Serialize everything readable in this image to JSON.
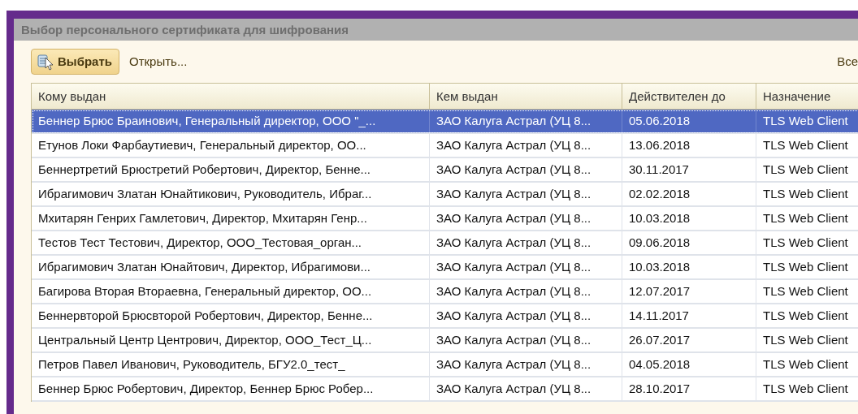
{
  "window": {
    "title": "Выбор персонального сертификата для шифрования"
  },
  "toolbar": {
    "select_button": "Выбрать",
    "open_button": "Открыть...",
    "all_actions": "Все"
  },
  "table": {
    "columns": [
      "Кому выдан",
      "Кем выдан",
      "Действителен до",
      "Назначение"
    ],
    "rows": [
      {
        "selected": true,
        "cells": [
          "Беннер Брюс Браинович, Генеральный директор, ООО \"_...",
          "ЗАО Калуга Астрал (УЦ 8...",
          "05.06.2018",
          "TLS Web Client"
        ]
      },
      {
        "selected": false,
        "cells": [
          "Етунов Локи Фарбаутиевич, Генеральный директор, ОО...",
          "ЗАО Калуга Астрал (УЦ 8...",
          "13.06.2018",
          "TLS Web Client"
        ]
      },
      {
        "selected": false,
        "cells": [
          "Беннертретий Брюстретий Робертович, Директор, Бенне...",
          "ЗАО Калуга Астрал (УЦ 8...",
          "30.11.2017",
          "TLS Web Client"
        ]
      },
      {
        "selected": false,
        "cells": [
          "Ибрагимович Златан Юнайтикович, Руководитель, Ибраг...",
          "ЗАО Калуга Астрал (УЦ 8...",
          "02.02.2018",
          "TLS Web Client"
        ]
      },
      {
        "selected": false,
        "cells": [
          "Мхитарян Генрих Гамлетович, Директор, Мхитарян Генр...",
          "ЗАО Калуга Астрал (УЦ 8...",
          "10.03.2018",
          "TLS Web Client"
        ]
      },
      {
        "selected": false,
        "cells": [
          "Тестов Тест Тестович, Директор, ООО_Тестовая_орган...",
          "ЗАО Калуга Астрал (УЦ 8...",
          "09.06.2018",
          "TLS Web Client"
        ]
      },
      {
        "selected": false,
        "cells": [
          "Ибрагимович Златан Юнайтович, Директор, Ибрагимови...",
          "ЗАО Калуга Астрал (УЦ 8...",
          "10.03.2018",
          "TLS Web Client"
        ]
      },
      {
        "selected": false,
        "cells": [
          "Багирова Вторая Втораевна, Генеральный директор, ОО...",
          "ЗАО Калуга Астрал (УЦ 8...",
          "12.07.2017",
          "TLS Web Client"
        ]
      },
      {
        "selected": false,
        "cells": [
          "Беннервторой Брюсвторой Робертович, Директор, Бенне...",
          "ЗАО Калуга Астрал (УЦ 8...",
          "14.11.2017",
          "TLS Web Client"
        ]
      },
      {
        "selected": false,
        "cells": [
          "Центральный Центр Центрович, Директор, ООО_Тест_Ц...",
          "ЗАО Калуга Астрал (УЦ 8...",
          "26.07.2017",
          "TLS Web Client"
        ]
      },
      {
        "selected": false,
        "cells": [
          "Петров Павел Иванович, Руководитель, БГУ2.0_тест_",
          "ЗАО Калуга Астрал (УЦ 8...",
          "04.05.2018",
          "TLS Web Client"
        ]
      },
      {
        "selected": false,
        "cells": [
          "Беннер Брюс Робертович, Директор, Беннер Брюс Робер...",
          "ЗАО Калуга Астрал (УЦ 8...",
          "28.10.2017",
          "TLS Web Client"
        ]
      }
    ]
  }
}
